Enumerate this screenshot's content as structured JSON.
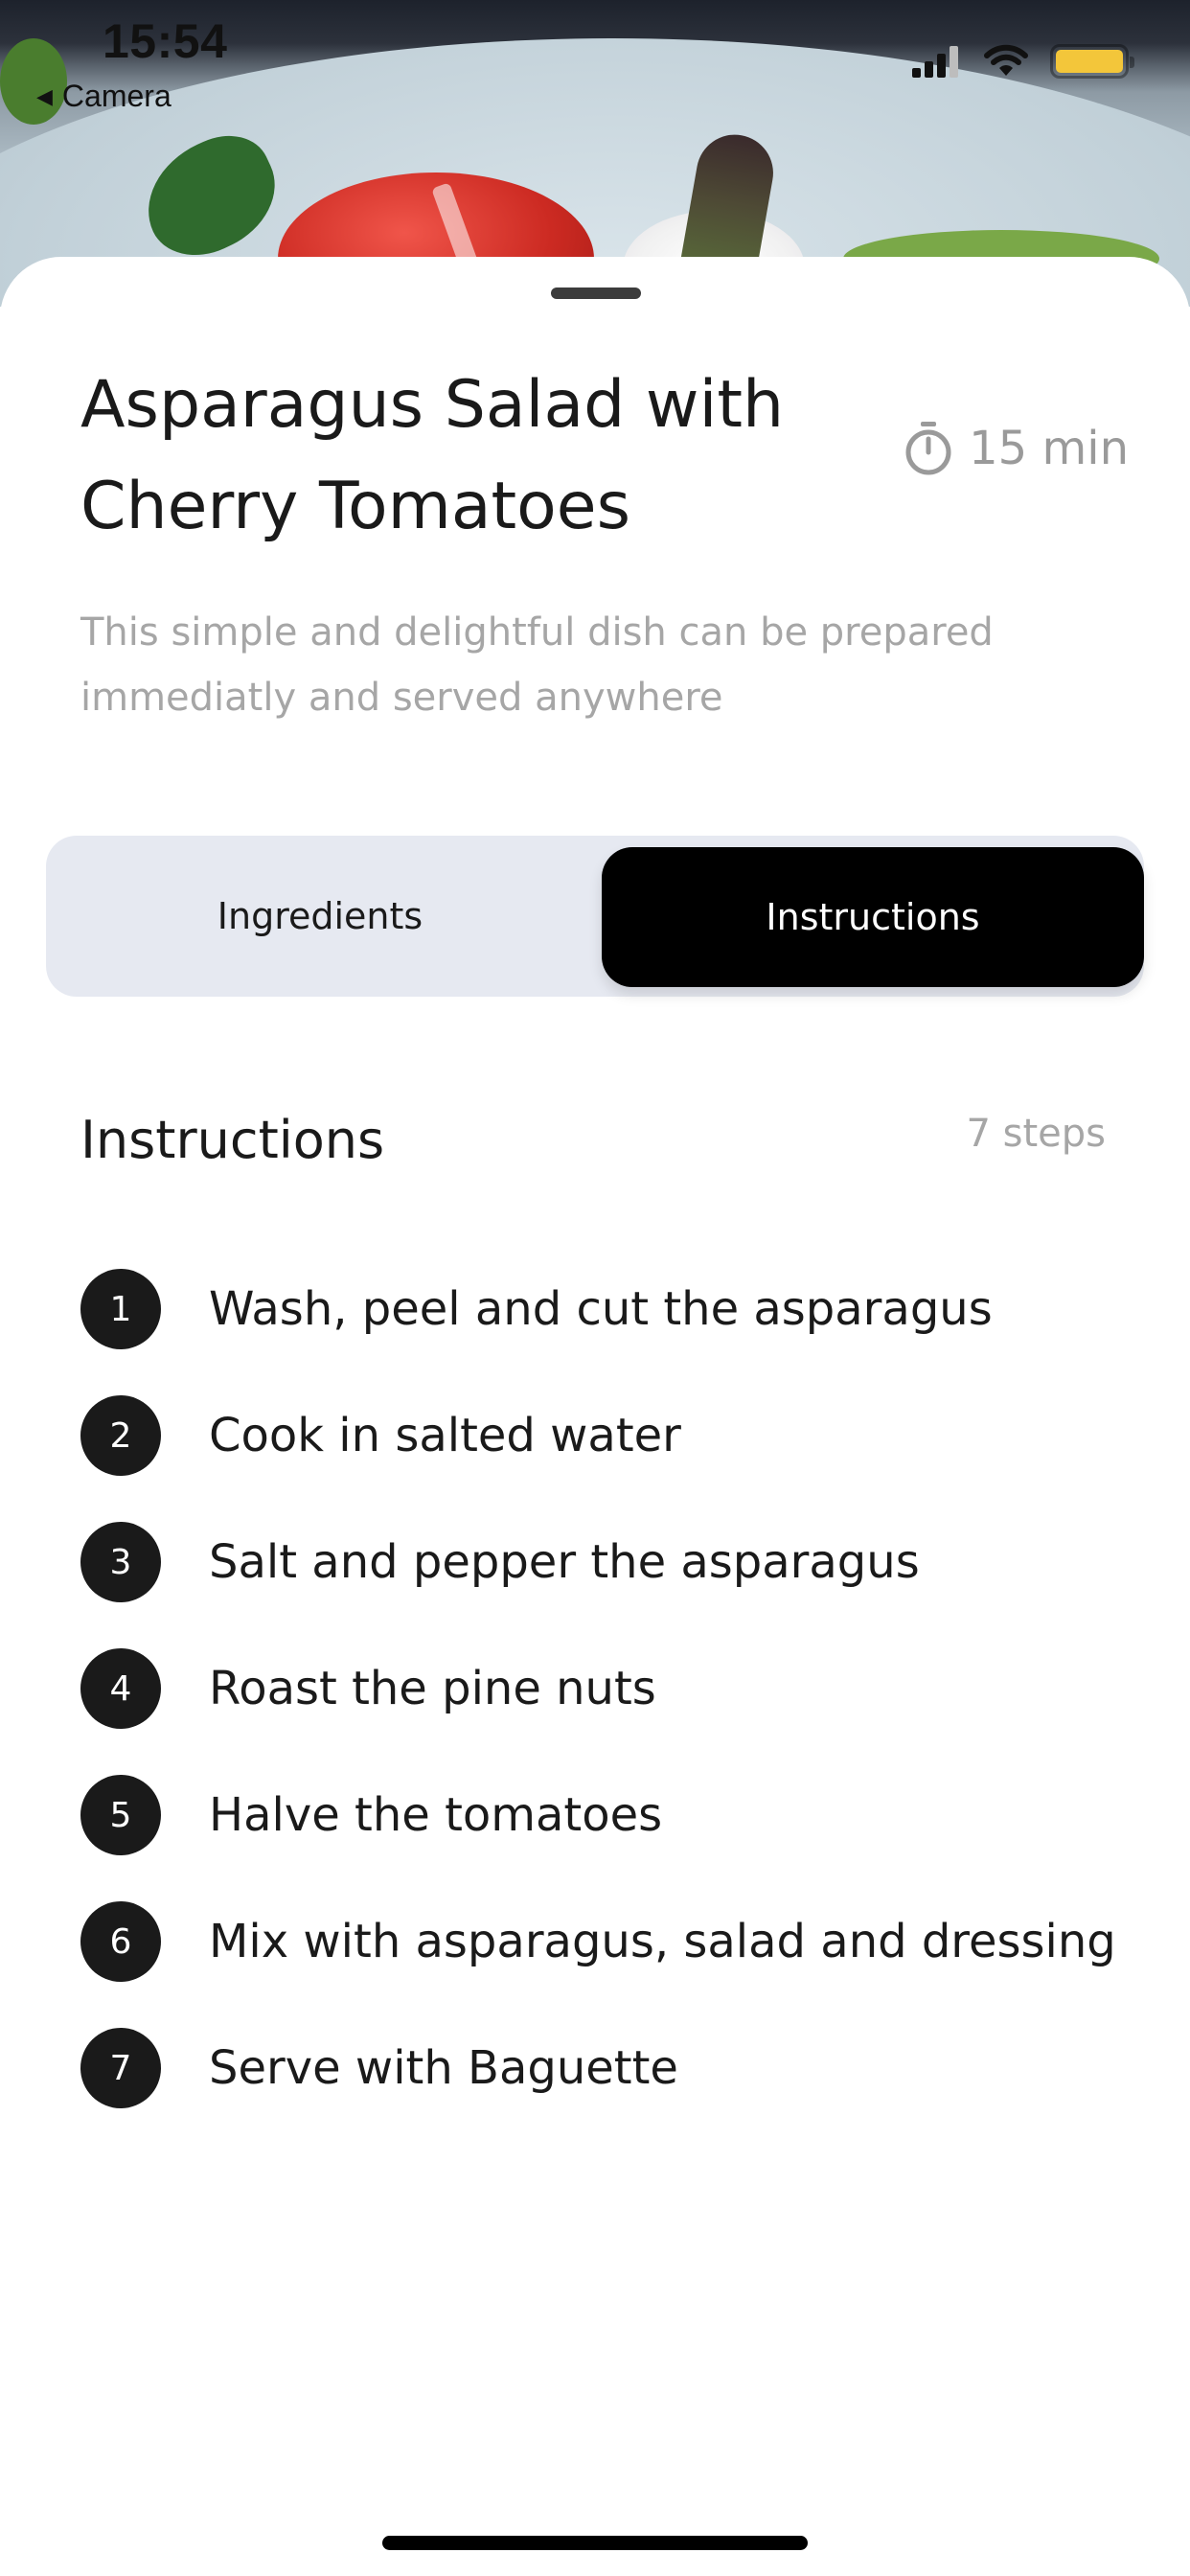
{
  "status_bar": {
    "time": "15:54",
    "back_app_label": "Camera"
  },
  "hero": {
    "image": "asparagus-salad-photo"
  },
  "recipe": {
    "title_line1": "Asparagus Salad with",
    "title_line2": "Cherry Tomatoes",
    "time": "15 min",
    "description_line1": "This simple and delightful dish can be prepared",
    "description_line2": "immediatly and served anywhere"
  },
  "tabs": {
    "ingredients": "Ingredients",
    "instructions": "Instructions",
    "selected": "Instructions"
  },
  "instructions": {
    "title": "Instructions",
    "count": "7 steps",
    "steps": [
      {
        "number": "1",
        "text": "Wash, peel and cut the asparagus"
      },
      {
        "number": "2",
        "text": "Cook in salted water"
      },
      {
        "number": "3",
        "text": "Salt and pepper the asparagus"
      },
      {
        "number": "4",
        "text": "Roast the pine nuts"
      },
      {
        "number": "5",
        "text": "Halve the tomatoes"
      },
      {
        "number": "6",
        "text": "Mix with asparagus, salad and dressing"
      },
      {
        "number": "7",
        "text": "Serve with Baguette"
      }
    ]
  },
  "colors": {
    "accent": "#000000",
    "segment_bg": "#e6e9f1",
    "muted_text": "#a6a6a6",
    "battery": "#f3c63a"
  }
}
